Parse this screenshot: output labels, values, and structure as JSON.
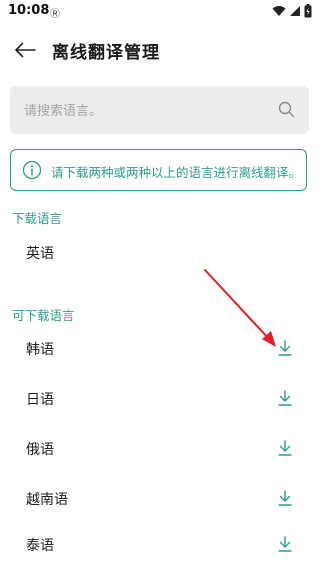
{
  "status": {
    "time": "10:08",
    "notification": "Ⓡ"
  },
  "header": {
    "title": "离线翻译管理"
  },
  "search": {
    "placeholder": "请搜索语言。"
  },
  "info": {
    "text": "请下载两种或两种以上的语言进行离线翻译。"
  },
  "downloaded": {
    "title": "下载语言",
    "items": [
      "英语"
    ]
  },
  "available": {
    "title": "可下载语言",
    "items": [
      "韩语",
      "日语",
      "俄语",
      "越南语",
      "泰语"
    ]
  },
  "colors": {
    "accent": "#2e9c8c",
    "annotation_arrow": "#e02020"
  }
}
